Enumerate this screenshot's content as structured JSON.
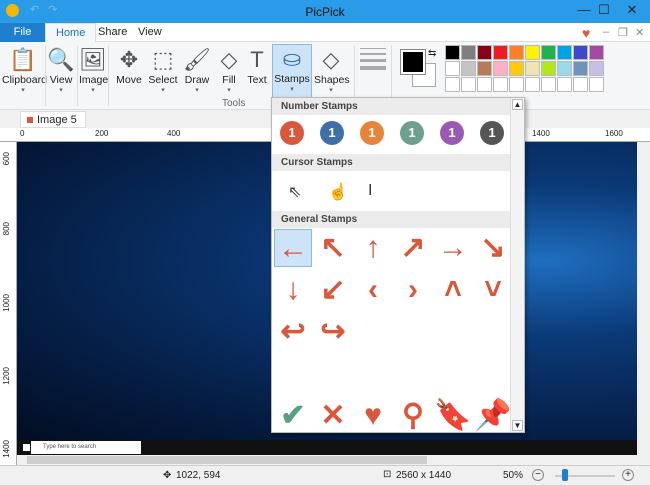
{
  "window": {
    "title": "PicPick",
    "minimize": "—",
    "maximize": "☐",
    "close": "✕"
  },
  "tabs": [
    {
      "label": "File"
    },
    {
      "label": "Home"
    },
    {
      "label": "Share"
    },
    {
      "label": "View"
    }
  ],
  "tab_controls": {
    "heart": "♥",
    "minimize": "–",
    "restore": "❐",
    "close": "✕"
  },
  "ribbon": {
    "tools": [
      {
        "label": "Clipboard",
        "icon": "clipboard-icon",
        "glyph": "📋"
      },
      {
        "label": "View",
        "icon": "view-icon",
        "glyph": "🔍"
      },
      {
        "label": "Image",
        "icon": "image-icon",
        "glyph": "🖼"
      },
      {
        "label": "Move",
        "icon": "move-icon",
        "glyph": "✥"
      },
      {
        "label": "Select",
        "icon": "select-icon",
        "glyph": "⬚"
      },
      {
        "label": "Draw",
        "icon": "brush-icon",
        "glyph": "🖌"
      },
      {
        "label": "Fill",
        "icon": "fill-bucket-icon",
        "glyph": "◇"
      },
      {
        "label": "Text",
        "icon": "text-icon",
        "glyph": "T"
      },
      {
        "label": "Stamps",
        "icon": "stamp-icon",
        "glyph": "⛀"
      },
      {
        "label": "Shapes",
        "icon": "shapes-icon",
        "glyph": "◇"
      }
    ],
    "group_label": "Tools",
    "palette": [
      "#000000",
      "#7f7f7f",
      "#880015",
      "#ed1c24",
      "#ff7f27",
      "#fff200",
      "#22b14c",
      "#00a2e8",
      "#3f48cc",
      "#a349a4",
      "#ffffff",
      "#c3c3c3",
      "#b97a57",
      "#ffaec9",
      "#ffc90e",
      "#efe4b0",
      "#b5e61d",
      "#99d9ea",
      "#7092be",
      "#c8bfe7",
      "#ffffff",
      "#ffffff",
      "#ffffff",
      "#ffffff",
      "#ffffff",
      "#ffffff",
      "#ffffff",
      "#ffffff",
      "#ffffff",
      "#ffffff"
    ],
    "primary_color": "#000000",
    "secondary_color": "#ffffff"
  },
  "document_tab": {
    "label": "Image 5",
    "close": "✕"
  },
  "ruler_top": [
    "0",
    "200",
    "400",
    "1400",
    "1600"
  ],
  "ruler_left": [
    "600",
    "800",
    "1000",
    "1200",
    "1400"
  ],
  "taskbar": {
    "search_placeholder": "Type here to search"
  },
  "stamps_panel": {
    "number_title": "Number Stamps",
    "number_label": "1",
    "number_colors": [
      "#d9573b",
      "#3f6fa8",
      "#e8843a",
      "#6fa08f",
      "#9b59b6",
      "#555555"
    ],
    "cursor_title": "Cursor Stamps",
    "cursors": [
      "⇖",
      "☝",
      "I"
    ],
    "general_title": "General Stamps",
    "general": [
      [
        "←",
        "↖",
        "↑",
        "↗",
        "→",
        "↘"
      ],
      [
        "↓",
        "↙",
        "‹",
        "›",
        "˄",
        "˅"
      ],
      [
        "↩",
        "↪"
      ],
      [
        "ⓘ",
        "?",
        "!",
        "✖",
        "⊖",
        "⊘"
      ],
      [
        "✔",
        "✕",
        "♥",
        "⚲",
        "🔖",
        "📌"
      ]
    ],
    "accent": "#d9573b"
  },
  "status": {
    "cursor_pos": "1022, 594",
    "image_size": "2560 x 1440",
    "zoom": "50%"
  }
}
